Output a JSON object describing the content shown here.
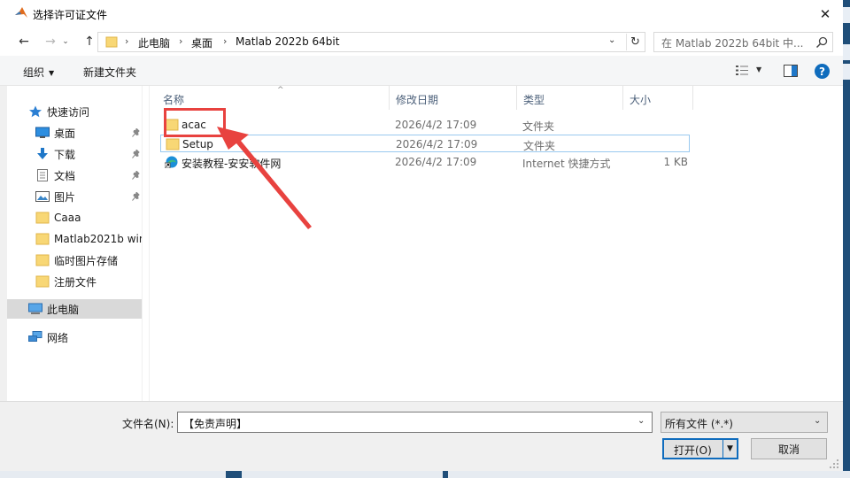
{
  "window": {
    "title": "选择许可证文件",
    "close_glyph": "✕"
  },
  "nav": {
    "back": "←",
    "forward": "→",
    "recent": "⌄",
    "up": "↑"
  },
  "address": {
    "separator": "›",
    "crumbs": [
      "此电脑",
      "桌面",
      "Matlab 2022b 64bit"
    ],
    "chevron": "⌄",
    "refresh": "↻"
  },
  "search": {
    "placeholder": "在 Matlab 2022b 64bit 中..."
  },
  "toolbar": {
    "organize": "组织",
    "organize_caret": "▼",
    "new_folder": "新建文件夹",
    "view_caret": "▼",
    "help": "?"
  },
  "sidebar": {
    "items": [
      {
        "label": "快速访问",
        "icon": "star-icon"
      },
      {
        "label": "桌面",
        "icon": "desktop-icon",
        "pinned": true
      },
      {
        "label": "下载",
        "icon": "download-icon",
        "pinned": true
      },
      {
        "label": "文档",
        "icon": "document-icon",
        "pinned": true
      },
      {
        "label": "图片",
        "icon": "picture-icon",
        "pinned": true
      },
      {
        "label": "Caaa",
        "icon": "folder-icon"
      },
      {
        "label": "Matlab2021b win",
        "icon": "folder-icon"
      },
      {
        "label": "临时图片存储",
        "icon": "folder-icon"
      },
      {
        "label": "注册文件",
        "icon": "folder-icon"
      },
      {
        "label": "此电脑",
        "icon": "computer-icon",
        "selected": true
      },
      {
        "label": "网络",
        "icon": "network-icon"
      }
    ]
  },
  "columns": {
    "name": "名称",
    "date": "修改日期",
    "type": "类型",
    "size": "大小"
  },
  "files": [
    {
      "name": "acac",
      "date": "2026/4/2 17:09",
      "type": "文件夹",
      "size": "",
      "icon": "folder-icon"
    },
    {
      "name": "Setup",
      "date": "2026/4/2 17:09",
      "type": "文件夹",
      "size": "",
      "icon": "folder-icon"
    },
    {
      "name": "安装教程-安安软件网",
      "date": "2026/4/2 17:09",
      "type": "Internet 快捷方式",
      "size": "1 KB",
      "icon": "edge-shortcut-icon"
    }
  ],
  "footer": {
    "filename_label": "文件名(N):",
    "filename_value": "【免责声明】",
    "filter_value": "所有文件 (*.*)",
    "open_button": "打开(O)",
    "cancel_button": "取消"
  },
  "colors": {
    "accent": "#0f6cbd",
    "annotation": "#e8423f",
    "folder": "#f8d775"
  }
}
